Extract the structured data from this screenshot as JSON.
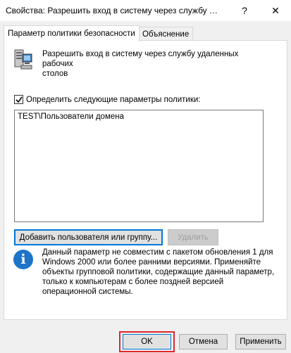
{
  "window": {
    "title": "Свойства: Разрешить вход в систему через службу уда...",
    "help_glyph": "?",
    "close_glyph": "✕"
  },
  "tabs": [
    {
      "label": "Параметр политики безопасности",
      "active": true
    },
    {
      "label": "Объяснение",
      "active": false
    }
  ],
  "policy": {
    "name_line1": "Разрешить вход в систему через службу удаленных рабочих",
    "name_line2": "столов",
    "icon": "server-computer-icon"
  },
  "define_checkbox": {
    "label": "Определить следующие параметры политики:",
    "checked": true
  },
  "user_list": {
    "items": [
      "TEST\\Пользователи домена"
    ]
  },
  "buttons": {
    "add": "Добавить пользователя или группу...",
    "remove": "Удалить",
    "ok": "OK",
    "cancel": "Отмена",
    "apply": "Применить"
  },
  "info": {
    "icon": "info-icon",
    "glyph": "i",
    "lines": [
      "Данный параметр не совместим с пакетом обновления 1 для",
      "Windows 2000 или более ранними версиями. Применяйте",
      "объекты групповой политики, содержащие данный параметр,",
      "только к компьютерам с более поздней версией",
      "операционной системы."
    ]
  },
  "colors": {
    "accent": "#0078d7",
    "info_blue": "#1e74c9",
    "highlight_red": "#e0262d"
  }
}
